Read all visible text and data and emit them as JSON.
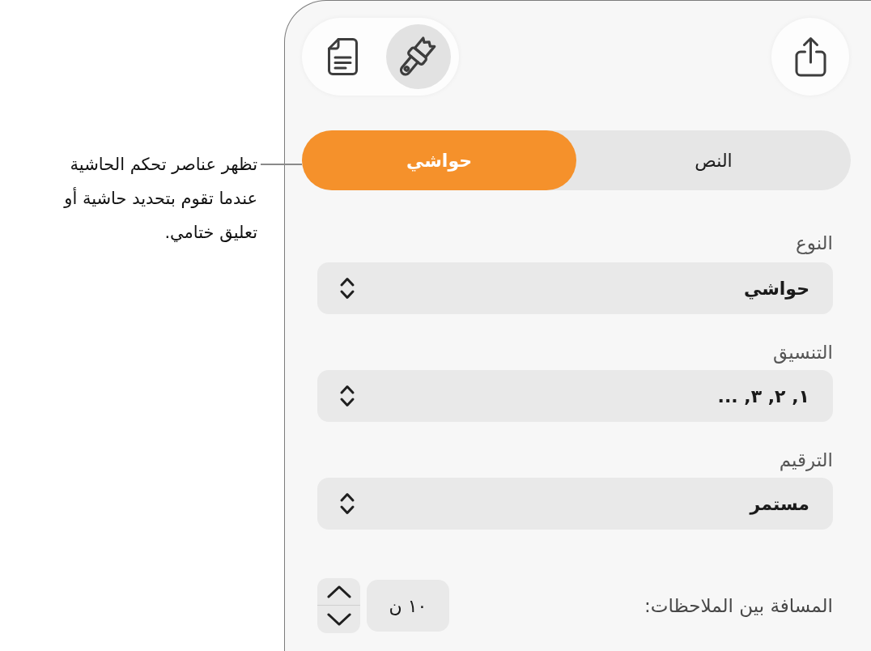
{
  "callout": {
    "text": "تظهر عناصر تحكم الحاشية عندما تقوم بتحديد حاشية أو تعليق ختامي."
  },
  "toolbar": {
    "view_buttons": [
      {
        "kind": "format",
        "selected": true
      },
      {
        "kind": "document",
        "selected": false
      }
    ]
  },
  "tabs": [
    {
      "label": "النص",
      "selected": false
    },
    {
      "label": "حواشي",
      "selected": true
    }
  ],
  "fields": [
    {
      "label": "النوع",
      "value": "حواشي"
    },
    {
      "label": "التنسيق",
      "value": "١, ٢, ٣, ..."
    },
    {
      "label": "الترقيم",
      "value": "مستمر"
    }
  ],
  "spacing": {
    "label": "المسافة بين الملاحظات:",
    "value": "١٠ ن"
  }
}
